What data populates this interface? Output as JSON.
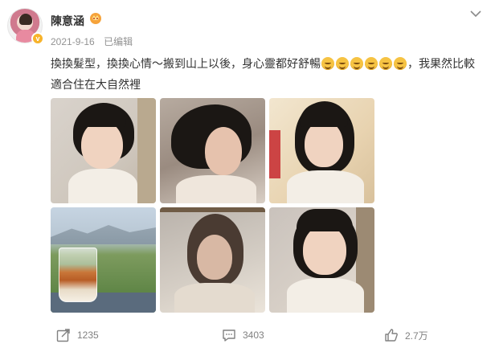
{
  "author": {
    "name": "陳意涵",
    "verified_badge": "v"
  },
  "meta": {
    "date": "2021-9-16",
    "edited": "已编辑"
  },
  "text": {
    "line1_a": "換換髮型，換換心情～搬到山上以後，身心靈都好舒暢",
    "line1_b": "，我果然比較",
    "line2": "適合住在大自然裡",
    "emoji_count": 6
  },
  "photos": [
    {
      "alt": "photo-1"
    },
    {
      "alt": "photo-2"
    },
    {
      "alt": "photo-3"
    },
    {
      "alt": "photo-4"
    },
    {
      "alt": "photo-5"
    },
    {
      "alt": "photo-6"
    }
  ],
  "footer": {
    "shares": "1235",
    "comments": "3403",
    "likes": "2.7万"
  },
  "colors": {
    "text": "#333333",
    "muted": "#939393",
    "badge": "#f7b32b",
    "icon": "#808080"
  },
  "icons": [
    "crown-icon",
    "more-chevron-icon",
    "share-icon",
    "comment-icon",
    "like-icon"
  ]
}
